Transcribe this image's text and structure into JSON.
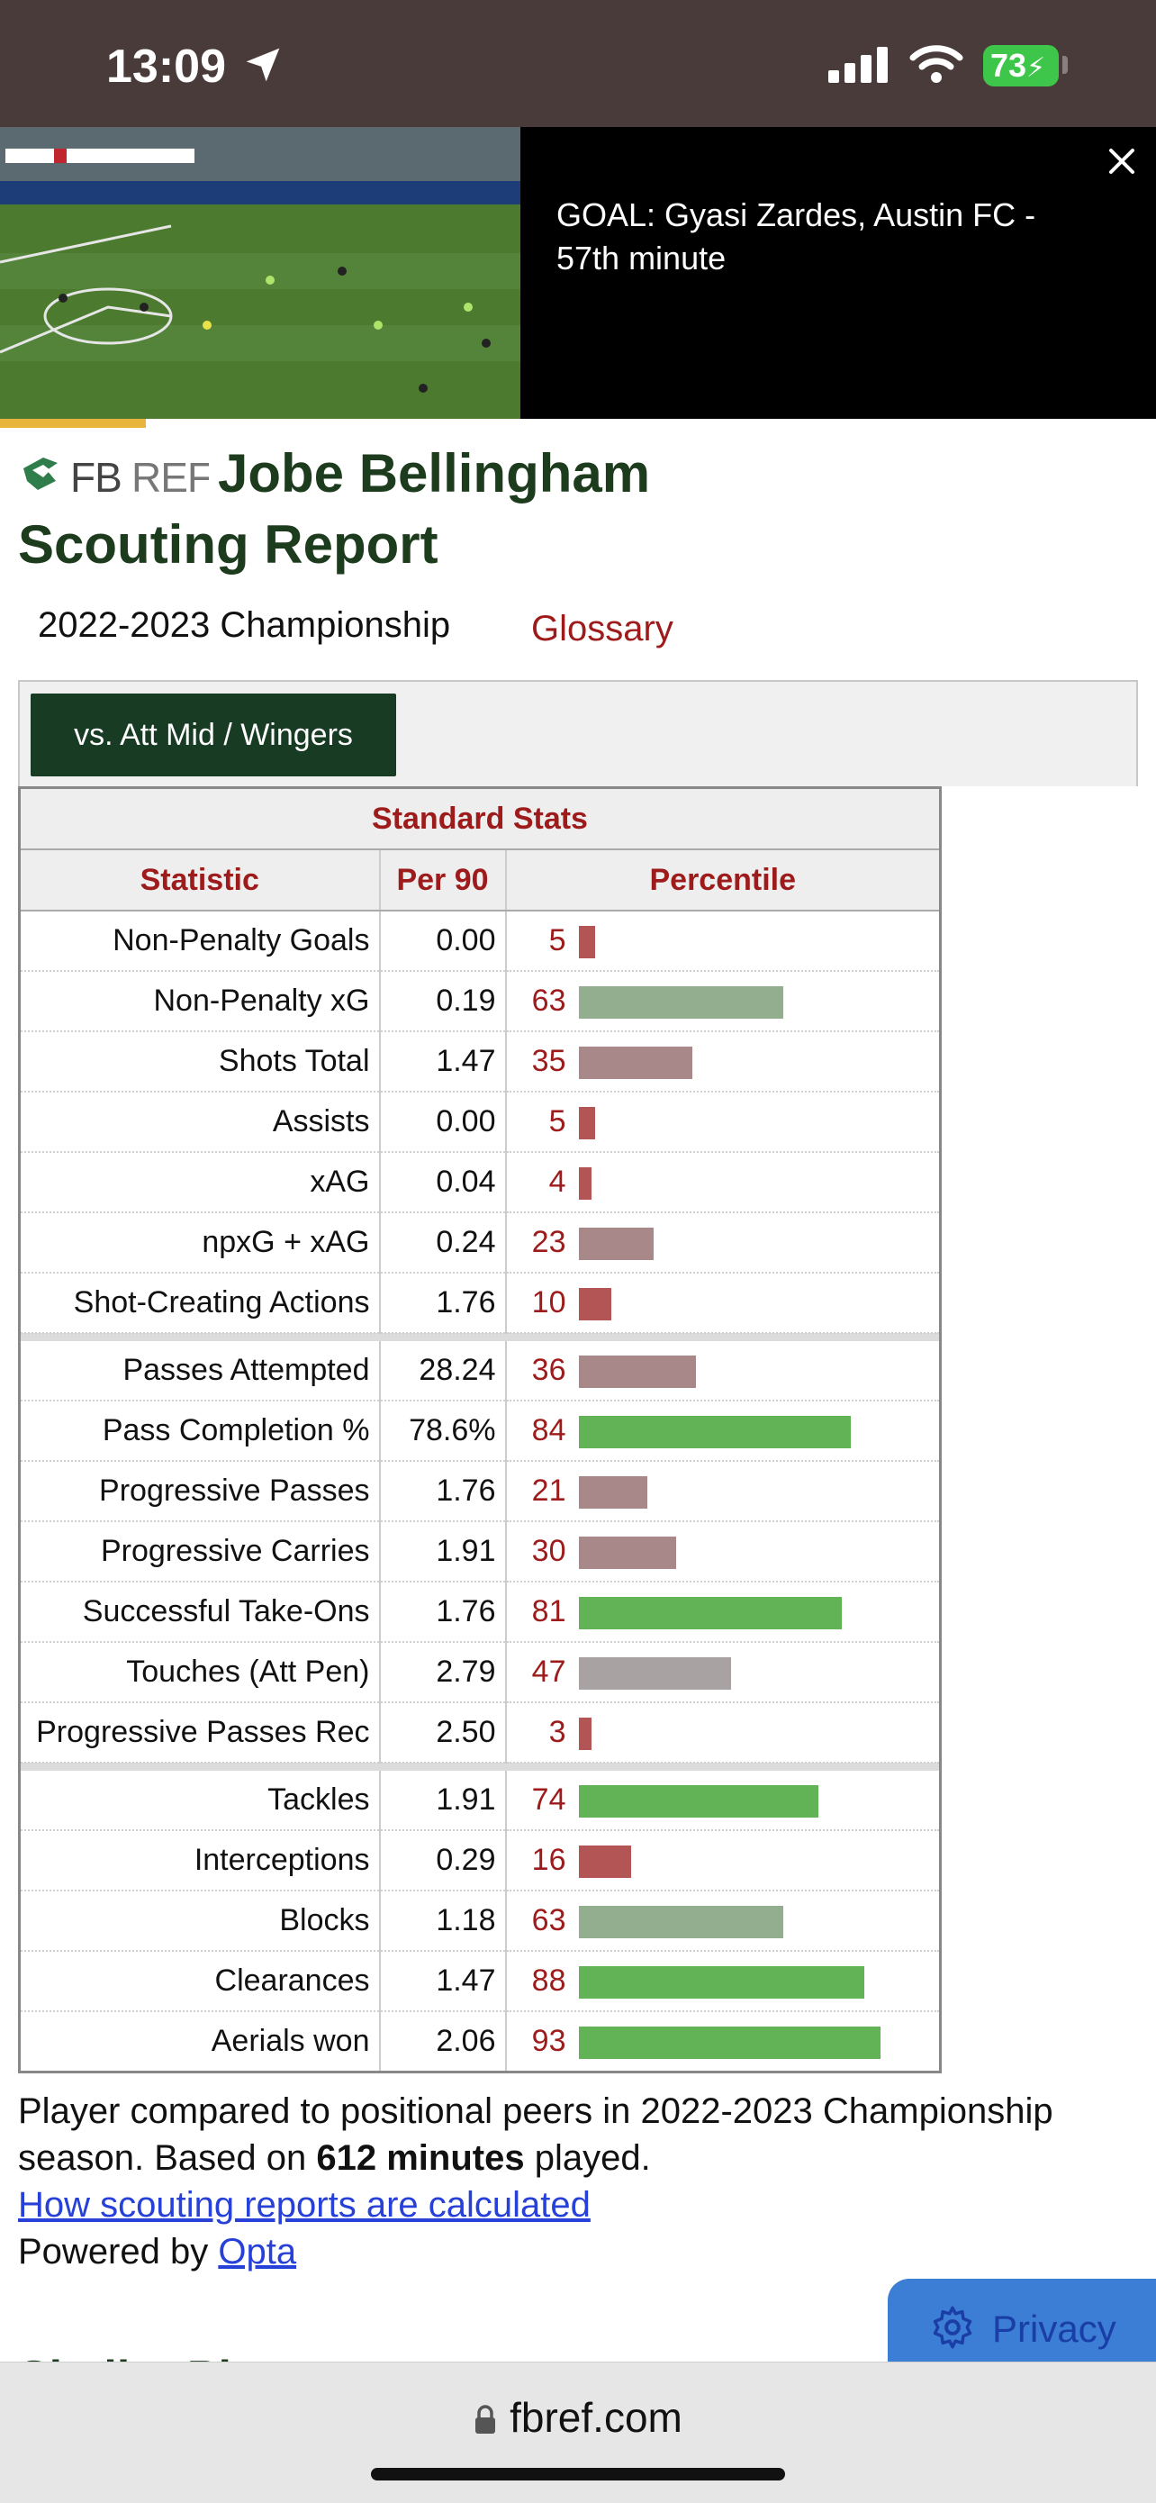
{
  "status_bar": {
    "time": "13:09",
    "battery": "73"
  },
  "video_banner": {
    "headline": "GOAL: Gyasi Zardes, Austin FC - 57th minute"
  },
  "header": {
    "logo_text": "FBREF",
    "title_line1": "Jobe Bellingham",
    "title_line2": "Scouting Report",
    "season": "2022-2023 Championship",
    "glossary": "Glossary"
  },
  "filter": {
    "label": "vs. Att Mid / Wingers"
  },
  "table": {
    "caption": "Standard Stats",
    "columns": [
      "Statistic",
      "Per 90",
      "Percentile"
    ],
    "groups": [
      [
        {
          "stat": "Non-Penalty Goals",
          "per90": "0.00",
          "pct": 5
        },
        {
          "stat": "Non-Penalty xG",
          "per90": "0.19",
          "pct": 63
        },
        {
          "stat": "Shots Total",
          "per90": "1.47",
          "pct": 35
        },
        {
          "stat": "Assists",
          "per90": "0.00",
          "pct": 5
        },
        {
          "stat": "xAG",
          "per90": "0.04",
          "pct": 4
        },
        {
          "stat": "npxG + xAG",
          "per90": "0.24",
          "pct": 23
        },
        {
          "stat": "Shot-Creating Actions",
          "per90": "1.76",
          "pct": 10
        }
      ],
      [
        {
          "stat": "Passes Attempted",
          "per90": "28.24",
          "pct": 36
        },
        {
          "stat": "Pass Completion %",
          "per90": "78.6%",
          "pct": 84
        },
        {
          "stat": "Progressive Passes",
          "per90": "1.76",
          "pct": 21
        },
        {
          "stat": "Progressive Carries",
          "per90": "1.91",
          "pct": 30
        },
        {
          "stat": "Successful Take-Ons",
          "per90": "1.76",
          "pct": 81
        },
        {
          "stat": "Touches (Att Pen)",
          "per90": "2.79",
          "pct": 47
        },
        {
          "stat": "Progressive Passes Rec",
          "per90": "2.50",
          "pct": 3
        }
      ],
      [
        {
          "stat": "Tackles",
          "per90": "1.91",
          "pct": 74
        },
        {
          "stat": "Interceptions",
          "per90": "0.29",
          "pct": 16
        },
        {
          "stat": "Blocks",
          "per90": "1.18",
          "pct": 63
        },
        {
          "stat": "Clearances",
          "per90": "1.47",
          "pct": 88
        },
        {
          "stat": "Aerials won",
          "per90": "2.06",
          "pct": 93
        }
      ]
    ]
  },
  "footer": {
    "text_before": "Player compared to positional peers in 2022-2023 Championship season. Based on ",
    "minutes": "612 minutes",
    "text_after": " played.",
    "link_how": "How scouting reports are calculated",
    "powered_by": "Powered by ",
    "link_opta": "Opta",
    "privacy": "Privacy",
    "next_section_peek": "Similar Players"
  },
  "browser": {
    "url": "fbref.com"
  },
  "colors": {
    "bar_low": "#b35555",
    "bar_lowmid": "#a88888",
    "bar_mid": "#a8a2a2",
    "bar_highmid": "#93ae8f",
    "bar_high": "#62b256",
    "accent_red": "#9e1b1b",
    "brand_green": "#173b23"
  }
}
